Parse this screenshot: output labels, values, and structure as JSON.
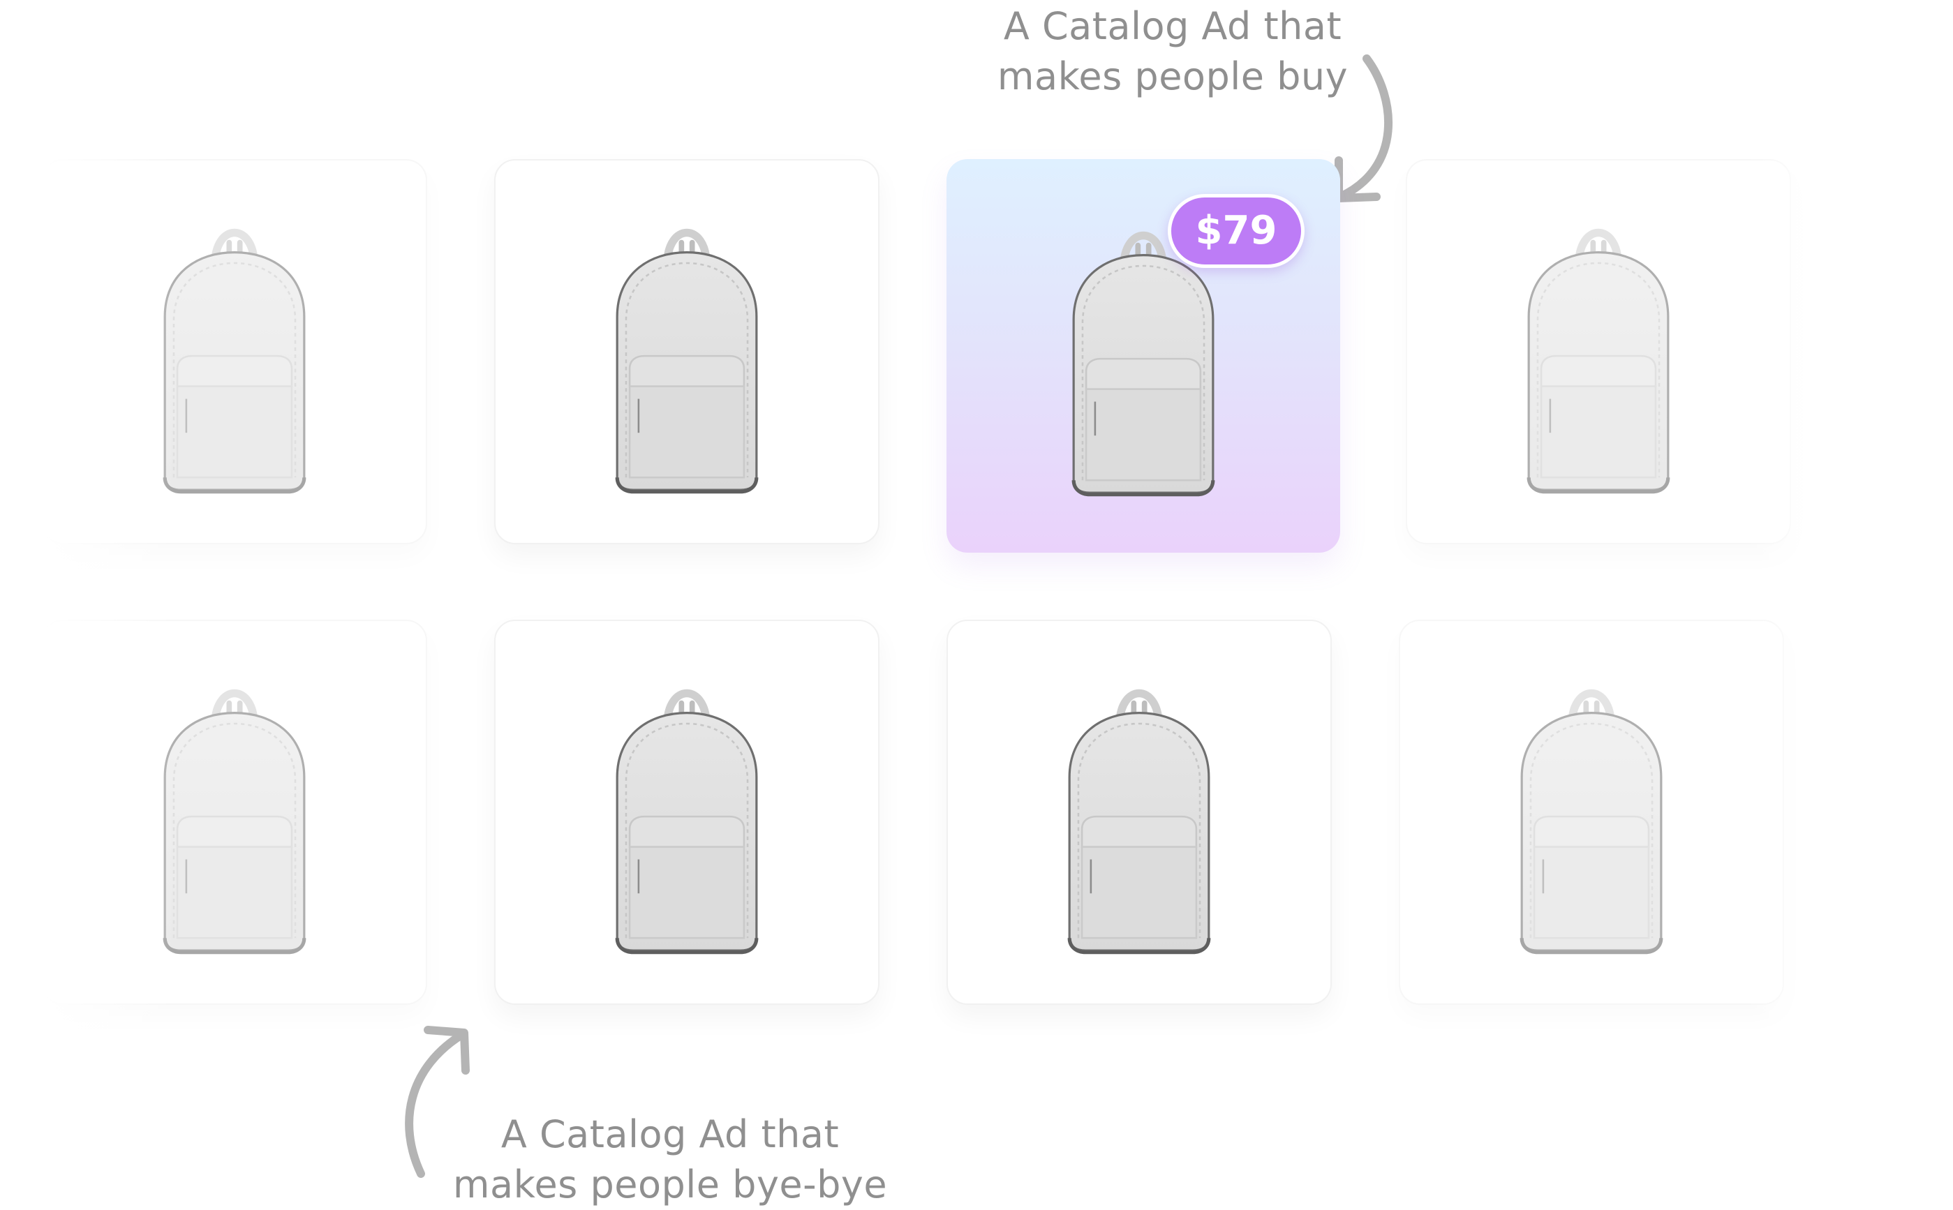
{
  "annotations": {
    "top": {
      "line1": "A Catalog Ad that",
      "line2": "makes people buy"
    },
    "bottom": {
      "line1": "A Catalog Ad that",
      "line2": "makes people bye-bye"
    }
  },
  "highlighted_ad": {
    "price": "$79",
    "badge_color": "#bd7cf6",
    "gradient": [
      "#dff0ff",
      "#e3e3fb",
      "#ead2fb"
    ]
  },
  "grid": {
    "rows": 2,
    "columns": 4,
    "product": "backpack-icon",
    "highlighted_position": {
      "row": 1,
      "column": 3
    }
  },
  "colors": {
    "caption": "#8f8f8f",
    "arrow": "#b4b4b4",
    "card_border": "#f1f1f1"
  }
}
